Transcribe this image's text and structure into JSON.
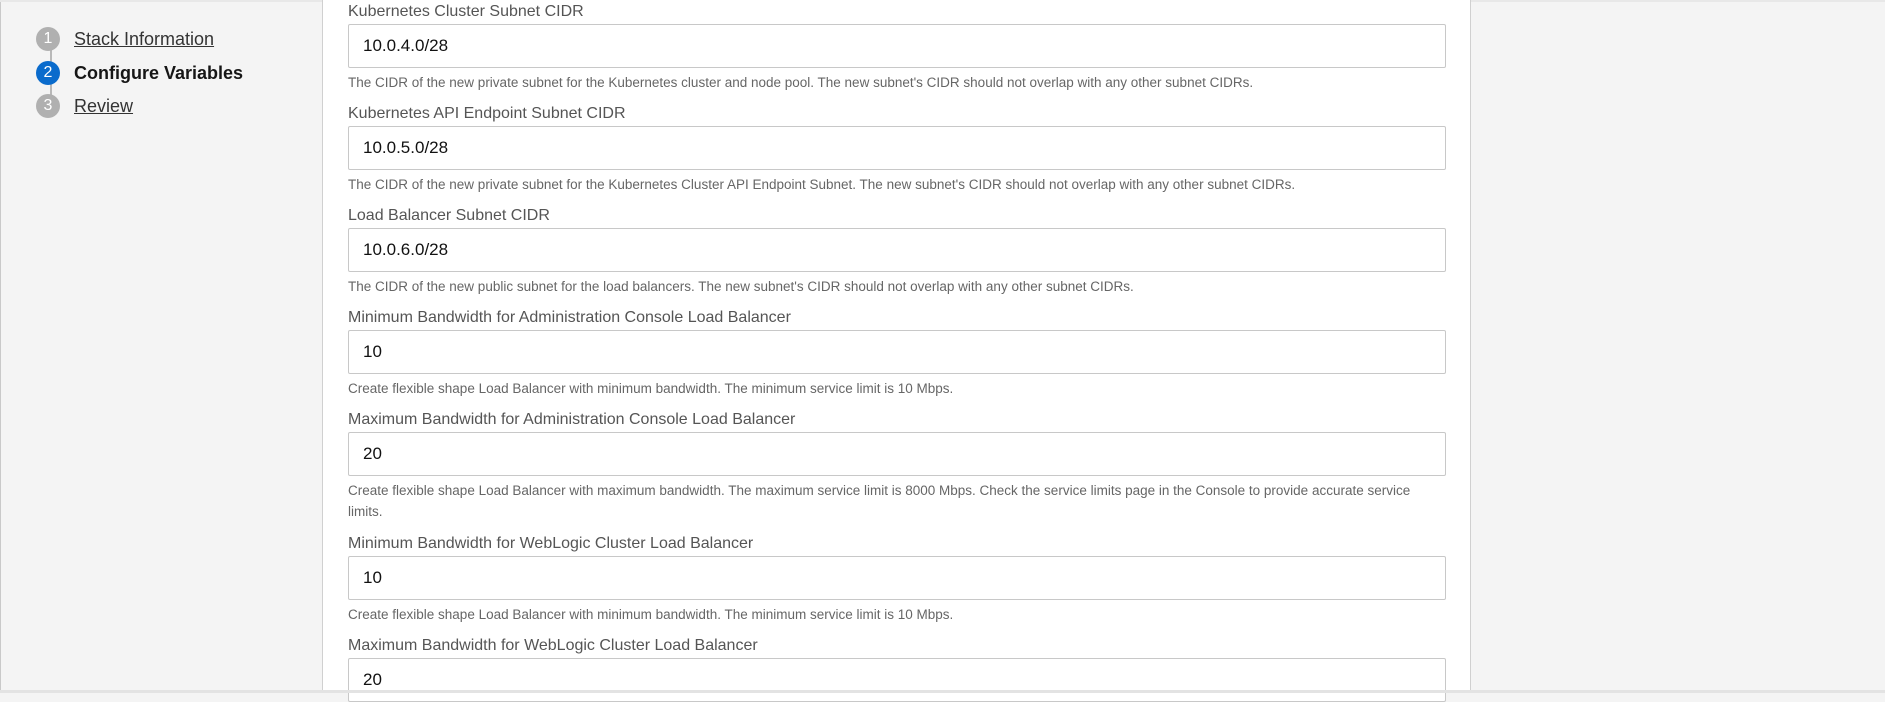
{
  "wizard": {
    "steps": [
      {
        "number": "1",
        "label": "Stack Information",
        "state": "complete"
      },
      {
        "number": "2",
        "label": "Configure Variables",
        "state": "current"
      },
      {
        "number": "3",
        "label": "Review",
        "state": "pending"
      }
    ]
  },
  "form": {
    "fields": [
      {
        "label": "Kubernetes Cluster Subnet CIDR",
        "value": "10.0.4.0/28",
        "help": "The CIDR of the new private subnet for the Kubernetes cluster and node pool. The new subnet's CIDR should not overlap with any other subnet CIDRs."
      },
      {
        "label": "Kubernetes API Endpoint Subnet CIDR",
        "value": "10.0.5.0/28",
        "help": "The CIDR of the new private subnet for the Kubernetes Cluster API Endpoint Subnet. The new subnet's CIDR should not overlap with any other subnet CIDRs."
      },
      {
        "label": "Load Balancer Subnet CIDR",
        "value": "10.0.6.0/28",
        "help": "The CIDR of the new public subnet for the load balancers. The new subnet's CIDR should not overlap with any other subnet CIDRs."
      },
      {
        "label": "Minimum Bandwidth for Administration Console Load Balancer",
        "value": "10",
        "help": "Create flexible shape Load Balancer with minimum bandwidth. The minimum service limit is 10 Mbps."
      },
      {
        "label": "Maximum Bandwidth for Administration Console Load Balancer",
        "value": "20",
        "help": "Create flexible shape Load Balancer with maximum bandwidth. The maximum service limit is 8000 Mbps. Check the service limits page in the Console to provide accurate service limits."
      },
      {
        "label": "Minimum Bandwidth for WebLogic Cluster Load Balancer",
        "value": "10",
        "help": "Create flexible shape Load Balancer with minimum bandwidth. The minimum service limit is 10 Mbps."
      },
      {
        "label": "Maximum Bandwidth for WebLogic Cluster Load Balancer",
        "value": "20",
        "help": ""
      }
    ]
  },
  "colors": {
    "accent": "#0a6bcc",
    "step_inactive": "#b0b0b0",
    "page_background": "#f4f4f4",
    "panel_background": "#ffffff"
  }
}
